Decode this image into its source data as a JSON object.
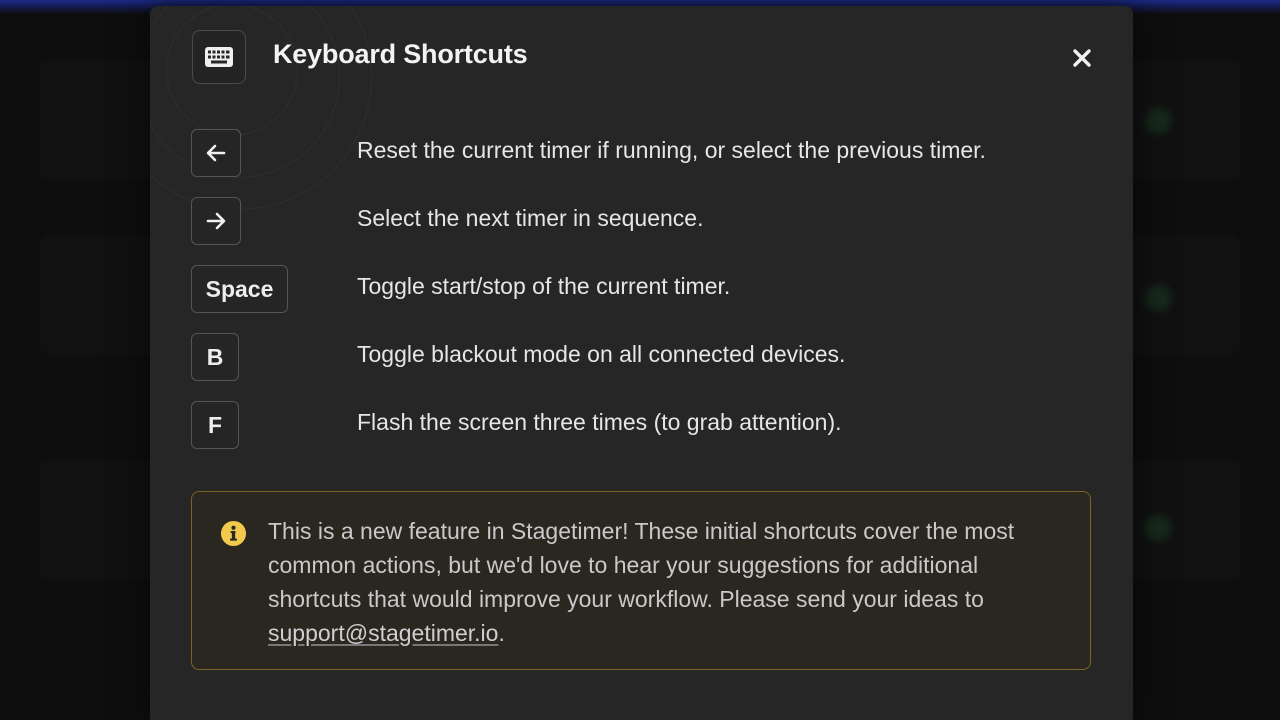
{
  "dialog": {
    "title": "Keyboard Shortcuts",
    "header_icon": "keyboard-icon",
    "close_icon": "close-icon"
  },
  "shortcuts": [
    {
      "key": "",
      "key_icon": "arrow-left-icon",
      "description": "Reset the current timer if running, or select the previous timer."
    },
    {
      "key": "",
      "key_icon": "arrow-right-icon",
      "description": "Select the next timer in sequence."
    },
    {
      "key": "Space",
      "description": "Toggle start/stop of the current timer."
    },
    {
      "key": "B",
      "description": "Toggle blackout mode on all connected devices."
    },
    {
      "key": "F",
      "description": "Flash the screen three times (to grab attention)."
    }
  ],
  "notice": {
    "icon": "info-icon",
    "text": "This is a new feature in Stagetimer! These initial shortcuts cover the most common actions, but we'd love to hear your suggestions for additional shortcuts that would improve your workflow. Please send your ideas to ",
    "link_text": "support@stagetimer.io",
    "text_end": "."
  },
  "colors": {
    "modal_bg": "#262626",
    "notice_border": "#7a6528",
    "info_yellow": "#f2c94c",
    "top_accent": "#1d2a86"
  }
}
